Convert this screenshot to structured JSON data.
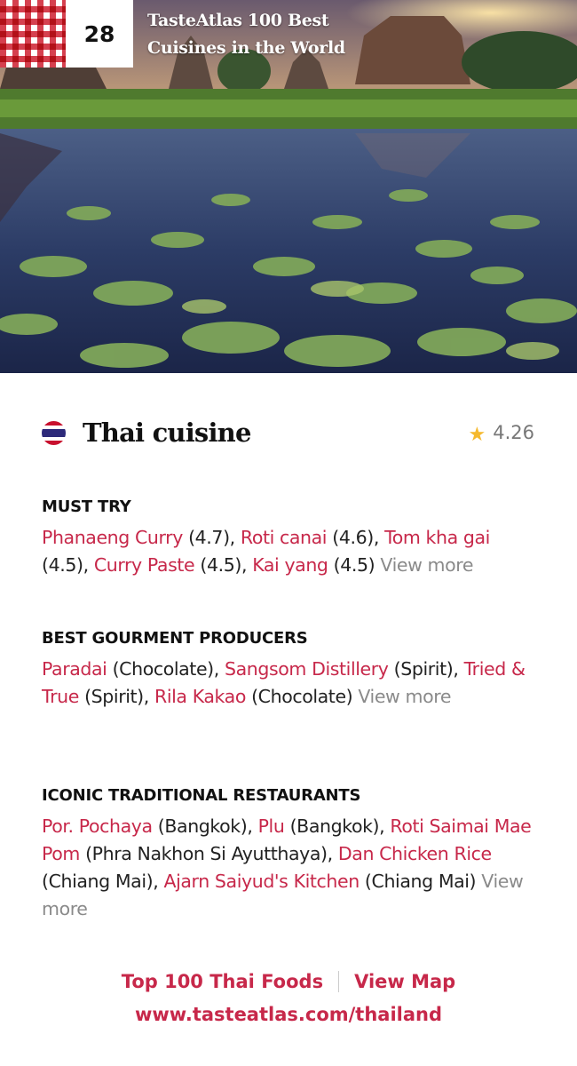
{
  "badge": {
    "rank": "28",
    "title": "TasteAtlas 100 Best Cuisines in the World"
  },
  "cuisine": {
    "name": "Thai cuisine",
    "rating": "4.26",
    "flag_icon": "thailand-flag-icon",
    "star_icon": "star-icon"
  },
  "sections": [
    {
      "title": "MUST TRY",
      "items": [
        {
          "name": "Phanaeng Curry",
          "detail": " (4.7), "
        },
        {
          "name": "Roti canai",
          "detail": " (4.6), "
        },
        {
          "name": "Tom kha gai",
          "detail": " (4.5), "
        },
        {
          "name": "Curry Paste",
          "detail": " (4.5), "
        },
        {
          "name": "Kai yang",
          "detail": " (4.5) "
        }
      ],
      "view_more": "View more"
    },
    {
      "title": "BEST GOURMENT PRODUCERS",
      "items": [
        {
          "name": "Paradai",
          "detail": " (Chocolate), "
        },
        {
          "name": "Sangsom Distillery",
          "detail": " (Spirit), "
        },
        {
          "name": "Tried & True",
          "detail": " (Spirit), "
        },
        {
          "name": "Rila Kakao",
          "detail": " (Chocolate) "
        }
      ],
      "view_more": "View more"
    },
    {
      "title": "ICONIC TRADITIONAL RESTAURANTS",
      "items": [
        {
          "name": "Por. Pochaya",
          "detail": " (Bangkok), "
        },
        {
          "name": "Plu",
          "detail": " (Bangkok), "
        },
        {
          "name": "Roti Saimai Mae Pom",
          "detail": " (Phra Nakhon Si Ayutthaya), "
        },
        {
          "name": "Dan Chicken Rice",
          "detail": " (Chiang Mai), "
        },
        {
          "name": "Ajarn Saiyud's Kitchen",
          "detail": " (Chiang Mai) "
        }
      ],
      "view_more": "View more"
    }
  ],
  "footer": {
    "top_foods": "Top 100 Thai Foods",
    "view_map": "View Map",
    "website": "www.tasteatlas.com/thailand"
  },
  "colors": {
    "accent": "#c7284a",
    "muted": "#8a8a8a",
    "star": "#f5b92e"
  }
}
